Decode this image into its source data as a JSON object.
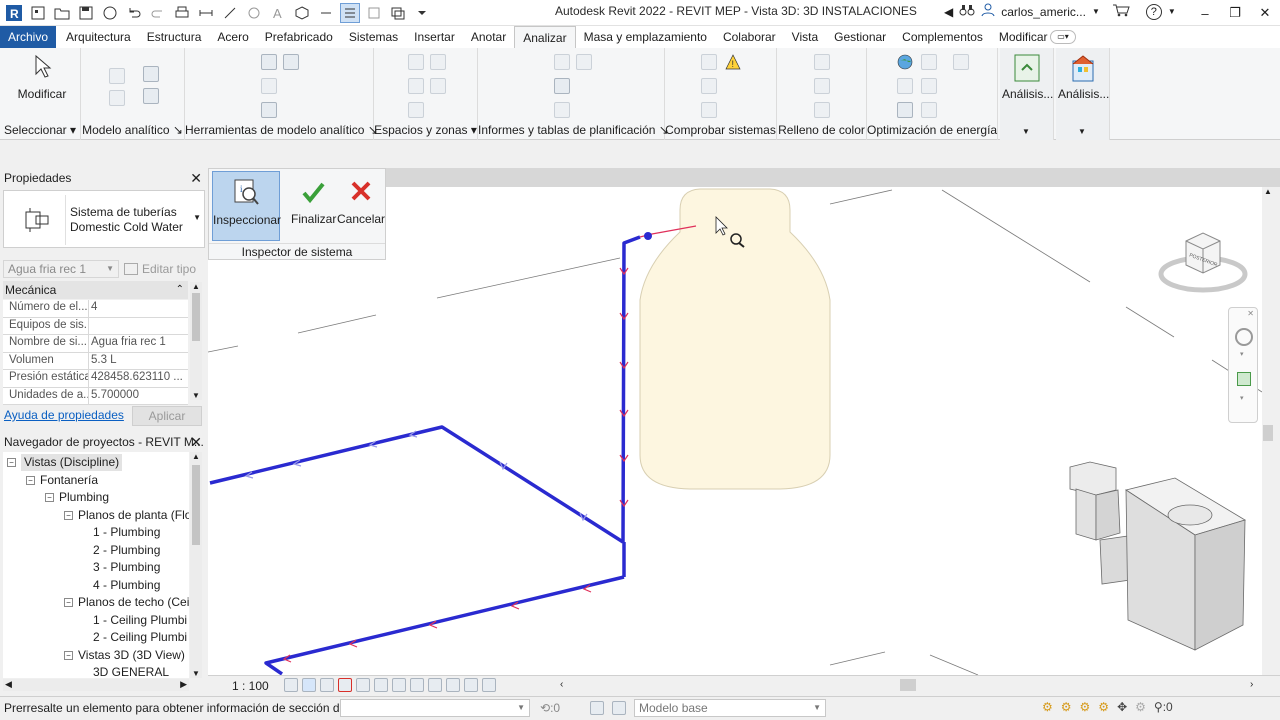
{
  "titlebar": {
    "app_title": "Autodesk Revit 2022 - REVIT MEP - Vista 3D: 3D INSTALACIONES",
    "user_name": "carlos_americ...",
    "help_symbol": "?",
    "min": "–",
    "max": "❐",
    "close": "✕"
  },
  "ribbon_tabs": [
    "Archivo",
    "Arquitectura",
    "Estructura",
    "Acero",
    "Prefabricado",
    "Sistemas",
    "Insertar",
    "Anotar",
    "Analizar",
    "Masa y emplazamiento",
    "Colaborar",
    "Vista",
    "Gestionar",
    "Complementos",
    "Modificar"
  ],
  "active_tab": "Analizar",
  "ribbon": {
    "modify_label": "Modificar",
    "panels": [
      "Seleccionar",
      "Modelo analítico",
      "Herramientas de modelo analítico",
      "Espacios y zonas",
      "Informes y tablas de planificación",
      "Comprobar sistemas",
      "Relleno de color",
      "Optimización de energía"
    ],
    "analysis_btn1": "Análisis...",
    "analysis_btn2": "Análisis..."
  },
  "inspector": {
    "inspect_label": "Inspeccionar",
    "finish_label": "Finalizar",
    "cancel_label": "Cancelar",
    "panel_label": "Inspector de sistema"
  },
  "properties": {
    "title": "Propiedades",
    "type_line1": "Sistema de tuberías",
    "type_line2": "Domestic Cold Water",
    "instance_filter": "Agua fria rec 1",
    "edit_type": "Editar tipo",
    "group": "Mecánica",
    "rows": [
      {
        "k": "Número de el...",
        "v": "4"
      },
      {
        "k": "Equipos de sis...",
        "v": ""
      },
      {
        "k": "Nombre de si...",
        "v": "Agua fria rec 1"
      },
      {
        "k": "Volumen",
        "v": "5.3 L"
      },
      {
        "k": "Presión estática",
        "v": "428458.623110 ..."
      },
      {
        "k": "Unidades de a...",
        "v": "5.700000"
      }
    ],
    "help_link": "Ayuda de propiedades",
    "apply": "Aplicar"
  },
  "browser": {
    "title": "Navegador de proyectos - REVIT M...",
    "nodes": [
      {
        "label": "Vistas (Discipline)",
        "level": 0,
        "box": "−"
      },
      {
        "label": "Fontanería",
        "level": 1,
        "box": "−"
      },
      {
        "label": "Plumbing",
        "level": 2,
        "box": "−"
      },
      {
        "label": "Planos de planta (Floo",
        "level": 3,
        "box": "−"
      },
      {
        "label": "1 - Plumbing",
        "level": 4,
        "box": ""
      },
      {
        "label": "2 - Plumbing",
        "level": 4,
        "box": ""
      },
      {
        "label": "3 - Plumbing",
        "level": 4,
        "box": ""
      },
      {
        "label": "4 - Plumbing",
        "level": 4,
        "box": ""
      },
      {
        "label": "Planos de techo (Ceili",
        "level": 3,
        "box": "−"
      },
      {
        "label": "1 - Ceiling Plumbi",
        "level": 4,
        "box": ""
      },
      {
        "label": "2 - Ceiling Plumbi",
        "level": 4,
        "box": ""
      },
      {
        "label": "Vistas 3D (3D View)",
        "level": 3,
        "box": "−"
      },
      {
        "label": "3D GENERAL",
        "level": 4,
        "box": ""
      }
    ]
  },
  "view_control": {
    "scale": "1 : 100"
  },
  "viewcube": {
    "face_label": "POSTERIOR"
  },
  "statusbar": {
    "message": "Prerresalte un elemento para obtener información de sección d",
    "sel_count": ":0",
    "model": "Modelo base",
    "filter_count": ":0"
  },
  "colors": {
    "file_tab": "#1f5ba5",
    "pipe": "#2a2ad0",
    "flow_arrow": "#e0305a",
    "tank_fill": "#fdf6e0",
    "inspect_active": "#bcd5ee"
  }
}
